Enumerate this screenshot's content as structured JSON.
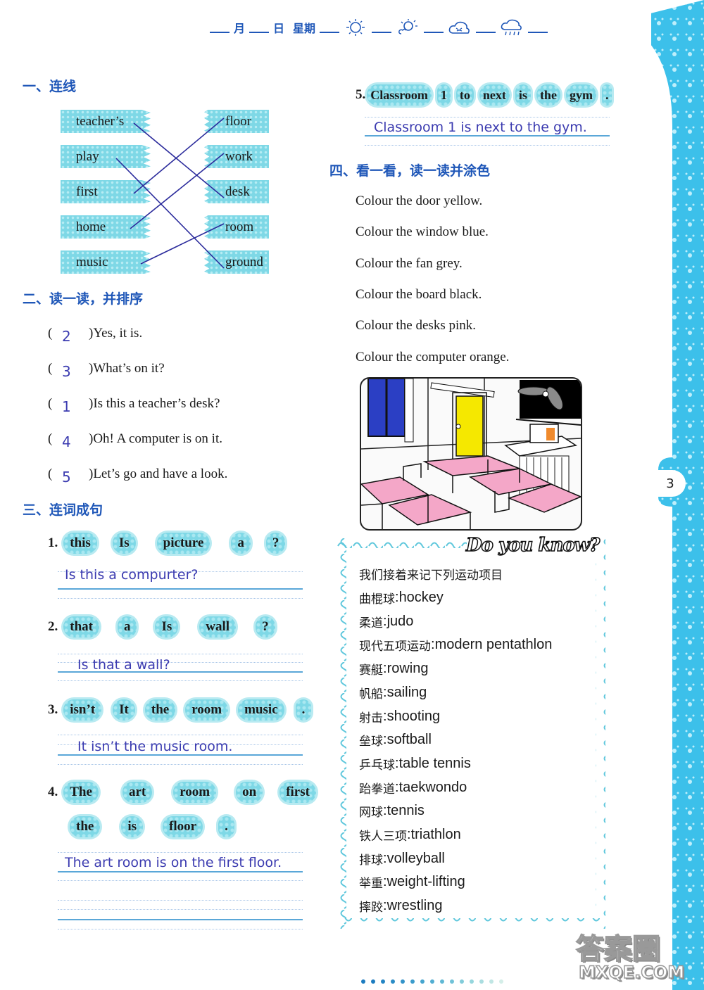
{
  "header": {
    "month_label": "月",
    "day_label": "日",
    "weekday_label": "星期",
    "weather_icons": [
      "sunny-icon",
      "partly-sunny-icon",
      "cloudy-icon",
      "rainy-icon"
    ]
  },
  "section1": {
    "title": "一、连线",
    "left_words": [
      "teacher’s",
      "play",
      "first",
      "home",
      "music"
    ],
    "right_words": [
      "floor",
      "work",
      "desk",
      "room",
      "ground"
    ],
    "matches": [
      {
        "left": "teacher’s",
        "right": "desk"
      },
      {
        "left": "play",
        "right": "ground"
      },
      {
        "left": "first",
        "right": "floor"
      },
      {
        "left": "home",
        "right": "work"
      },
      {
        "left": "music",
        "right": "room"
      }
    ]
  },
  "section2": {
    "title": "二、读一读，并排序",
    "items": [
      {
        "answer": "2",
        "text": ")Yes, it is."
      },
      {
        "answer": "3",
        "text": ")What’s on it?"
      },
      {
        "answer": "1",
        "text": ")Is this a teacher’s desk?"
      },
      {
        "answer": "4",
        "text": ")Oh!   A computer is on it."
      },
      {
        "answer": "5",
        "text": ")Let’s go and have a look."
      }
    ],
    "open_paren": "("
  },
  "section3": {
    "title": "三、连词成句",
    "questions": [
      {
        "num": "1.",
        "words": [
          "this",
          "Is",
          "picture",
          "a",
          "?"
        ],
        "answer": "Is this a compurter?"
      },
      {
        "num": "2.",
        "words": [
          "that",
          "a",
          "Is",
          "wall",
          "?"
        ],
        "answer": "Is that a wall?"
      },
      {
        "num": "3.",
        "words": [
          "isn’t",
          "It",
          "the",
          "room",
          "music",
          "."
        ],
        "answer": "It isn’t the music room."
      },
      {
        "num": "4.",
        "words": [
          "The",
          "art",
          "room",
          "on",
          "first"
        ],
        "words2": [
          "the",
          "is",
          "floor",
          "."
        ],
        "answer": "The art room is on the first floor."
      },
      {
        "num": "5.",
        "words": [
          "Classroom",
          "1",
          "to",
          "next",
          "is",
          "the",
          "gym",
          "."
        ],
        "answer": "Classroom 1 is next to the gym."
      }
    ]
  },
  "section4": {
    "title": "四、看一看，读一读并涂色",
    "instructions": [
      "Colour the door yellow.",
      "Colour the window blue.",
      "Colour the fan grey.",
      "Colour the board black.",
      "Colour the desks pink.",
      "Colour the computer orange."
    ],
    "colors": {
      "door": "#f5e800",
      "window": "#2b3fc4",
      "fan": "#8a8a8a",
      "board": "#000000",
      "desks": "#f4a7c8",
      "computer": "#f08a2c"
    }
  },
  "know_box": {
    "title": "Do you know?",
    "intro": "我们接着来记下列运动项目",
    "items": [
      {
        "cn": "曲棍球",
        "en": "hockey"
      },
      {
        "cn": "柔道",
        "en": "judo"
      },
      {
        "cn": "现代五项运动",
        "en": "modern pentathlon"
      },
      {
        "cn": "赛艇",
        "en": "rowing"
      },
      {
        "cn": "帆船",
        "en": "sailing"
      },
      {
        "cn": "射击",
        "en": "shooting"
      },
      {
        "cn": "垒球",
        "en": "softball"
      },
      {
        "cn": "乒乓球",
        "en": "table tennis"
      },
      {
        "cn": "跆拳道",
        "en": "taekwondo"
      },
      {
        "cn": "网球",
        "en": "tennis"
      },
      {
        "cn": "铁人三项",
        "en": "triathlon"
      },
      {
        "cn": "排球",
        "en": "volleyball"
      },
      {
        "cn": "举重",
        "en": "weight-lifting"
      },
      {
        "cn": "摔跤",
        "en": "wrestling"
      }
    ],
    "separator": ":"
  },
  "page_number": "3",
  "watermark": {
    "line1": "答案圈",
    "line2": "MXQE.COM"
  },
  "theme": {
    "accent": "#1f57b8",
    "answer_ink": "#3b3bb0",
    "cyan": "#7ed8e6",
    "strip": "#3cc0ea"
  }
}
